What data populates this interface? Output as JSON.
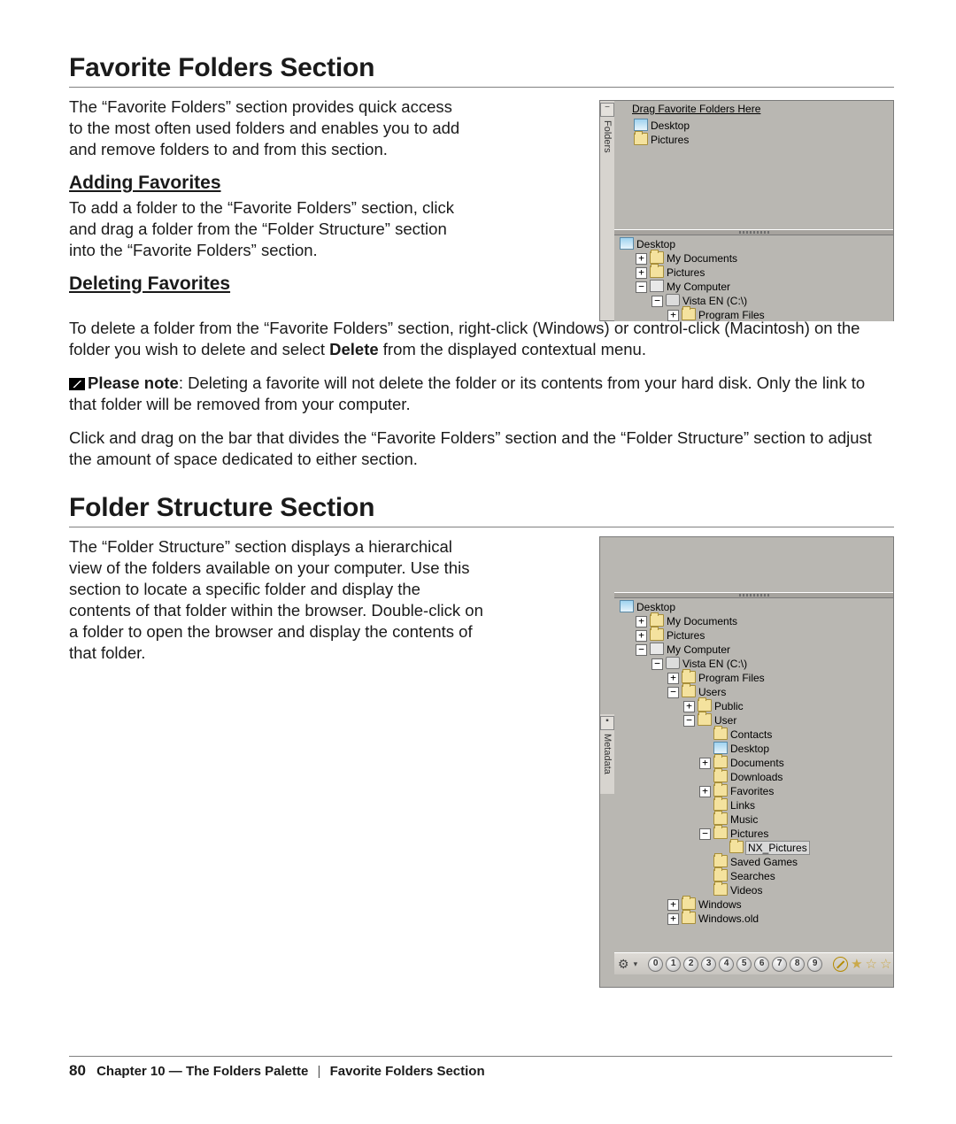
{
  "section1": {
    "title": "Favorite Folders Section",
    "intro": "The “Favorite Folders” section provides quick access to the most often used folders and enables you to add and remove folders to and from this section.",
    "adding_h": "Adding Favorites",
    "adding_p": "To add a folder to the “Favorite Folders” section, click and drag a folder from the “Folder Structure” section into the “Favorite Folders” section.",
    "deleting_h": "Deleting Favorites",
    "deleting_p_a": "To delete a folder from the “Favorite Folders” section, right-click (Windows) or control-click (Macintosh) on the folder you wish to delete and select ",
    "deleting_p_bold": "Delete",
    "deleting_p_b": " from the displayed contextual menu.",
    "note_prefix": "Please note",
    "note_body": ": Deleting a favorite will not delete the folder or its contents from your hard disk. Only the link to that folder will be removed from your computer.",
    "drag_p": "Click and drag on the bar that divides the “Favorite Folders” section and the “Folder Structure” section to adjust the amount of space dedicated to either section."
  },
  "section2": {
    "title": "Folder Structure Section",
    "intro": "The “Folder Structure” section displays a hierarchical view of the folders available on your computer. Use this section to locate a specific folder and display the contents of that folder within the browser. Double-click on a folder to open the browser and display the contents of that folder."
  },
  "panel1": {
    "tab_label": "Folders",
    "drag_msg": "Drag Favorite Folders Here",
    "fav_items": [
      "Desktop",
      "Pictures"
    ],
    "struct": {
      "root": "Desktop",
      "children": [
        "My Documents",
        "Pictures",
        "My Computer"
      ],
      "computer_children": [
        "Vista EN (C:\\)"
      ],
      "drive_children": [
        "Program Files"
      ]
    }
  },
  "panel2": {
    "tab_label": "Metadata",
    "desktop": "Desktop",
    "my_documents": "My Documents",
    "pictures": "Pictures",
    "my_computer": "My Computer",
    "drive": "Vista EN (C:\\)",
    "program_files": "Program Files",
    "users": "Users",
    "public": "Public",
    "user": "User",
    "user_children": [
      "Contacts",
      "Desktop",
      "Documents",
      "Downloads",
      "Favorites",
      "Links",
      "Music",
      "Pictures"
    ],
    "pictures_child": "NX_Pictures",
    "after_pictures": [
      "Saved Games",
      "Searches",
      "Videos"
    ],
    "windows": "Windows",
    "windows_old": "Windows.old",
    "ratings": [
      "0",
      "1",
      "2",
      "3",
      "4",
      "5",
      "6",
      "7",
      "8",
      "9"
    ]
  },
  "footer": {
    "page": "80",
    "chapter": "Chapter 10 — The Folders Palette",
    "crumb": "Favorite Folders Section"
  }
}
